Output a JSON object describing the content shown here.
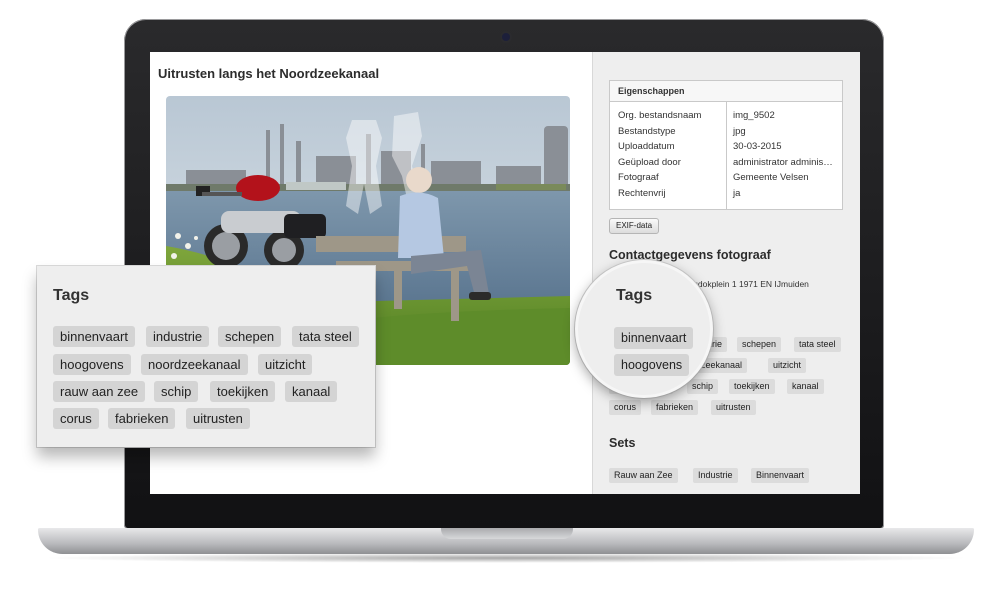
{
  "page": {
    "title": "Uitrusten langs het Noordzeekanaal"
  },
  "properties": {
    "header": "Eigenschappen",
    "rows": [
      {
        "key": "Org. bestandsnaam",
        "value": "img_9502"
      },
      {
        "key": "Bestandstype",
        "value": "jpg"
      },
      {
        "key": "Uploaddatum",
        "value": "30-03-2015"
      },
      {
        "key": "Geüpload door",
        "value": "administrator adminis…"
      },
      {
        "key": "Fotograaf",
        "value": "Gemeente Velsen"
      },
      {
        "key": "Rechtenvrij",
        "value": "ja"
      }
    ]
  },
  "exif_button": "EXIF-data",
  "contact": {
    "title": "Contactgegevens fotograaf",
    "address": "Dudokplein 1 1971 EN IJmuiden"
  },
  "tags": {
    "title": "Tags",
    "items": [
      "binnenvaart",
      "industrie",
      "schepen",
      "tata steel",
      "hoogovens",
      "noordzeekanaal",
      "uitzicht",
      "rauw aan zee",
      "schip",
      "toekijken",
      "kanaal",
      "corus",
      "fabrieken",
      "uitrusten"
    ]
  },
  "sets": {
    "title": "Sets",
    "items": [
      "Rauw aan Zee",
      "Industrie",
      "Binnenvaart"
    ]
  }
}
